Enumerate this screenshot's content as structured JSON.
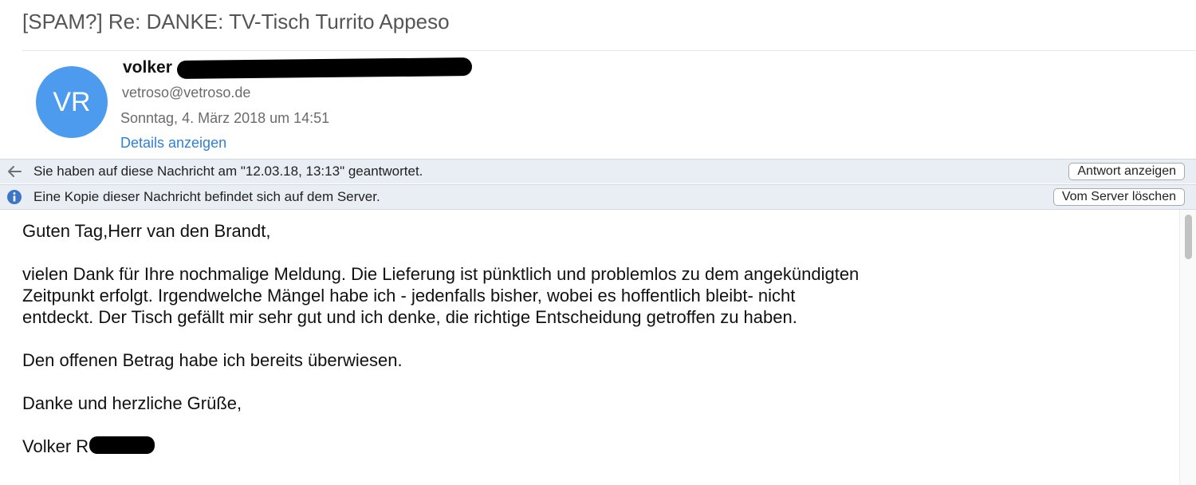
{
  "message": {
    "subject": "[SPAM?] Re: DANKE: TV-Tisch Turrito Appeso",
    "avatar_initials": "VR",
    "avatar_color": "#4d9bef",
    "sender_name": "volker",
    "sender_email": "vetroso@vetroso.de",
    "date": "Sonntag, 4. März 2018 um 14:51",
    "details_link": "Details anzeigen"
  },
  "notices": [
    {
      "icon": "reply-arrow-icon",
      "text": "Sie haben auf diese Nachricht am \"12.03.18, 13:13\" geantwortet.",
      "button": "Antwort anzeigen"
    },
    {
      "icon": "info-icon",
      "text": "Eine Kopie dieser Nachricht befindet sich auf dem Server.",
      "button": "Vom Server löschen"
    }
  ],
  "body": {
    "greeting": "Guten Tag,Herr van den Brandt,",
    "para1_line1": "vielen Dank für Ihre nochmalige Meldung. Die Lieferung ist pünktlich und problemlos zu dem angekündigten",
    "para1_line2": "Zeitpunkt erfolgt. Irgendwelche Mängel habe ich - jedenfalls bisher, wobei es hoffentlich bleibt- nicht",
    "para1_line3": "entdeckt. Der Tisch gefällt mir sehr gut und ich denke, die richtige Entscheidung getroffen zu haben.",
    "para2": "Den offenen Betrag habe ich bereits überwiesen.",
    "closing": "Danke und herzliche Grüße,",
    "signature": "Volker R"
  },
  "colors": {
    "link": "#2f7fd8",
    "notice_bar": "#e9edf4"
  }
}
